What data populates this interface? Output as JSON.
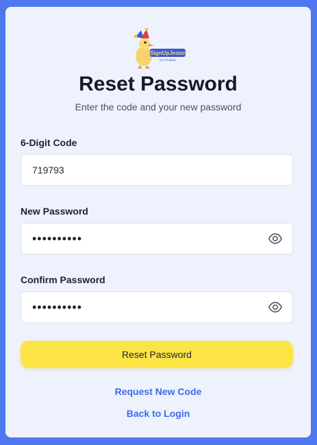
{
  "logo": {
    "brand": "SignUpJester",
    "byline": "by Omsport"
  },
  "header": {
    "title": "Reset Password",
    "subtitle": "Enter the code and your new password"
  },
  "form": {
    "code": {
      "label": "6-Digit Code",
      "value": "719793"
    },
    "new_password": {
      "label": "New Password",
      "value": "••••••••••"
    },
    "confirm_password": {
      "label": "Confirm Password",
      "value": "••••••••••"
    },
    "submit_label": "Reset Password"
  },
  "links": {
    "request_code": "Request New Code",
    "back_to_login": "Back to Login"
  },
  "colors": {
    "background": "#4f78f0",
    "card": "#eef2fd",
    "button": "#fde445",
    "link": "#3c6ce8"
  },
  "icons": [
    "jester-duck-logo",
    "eye-icon"
  ]
}
